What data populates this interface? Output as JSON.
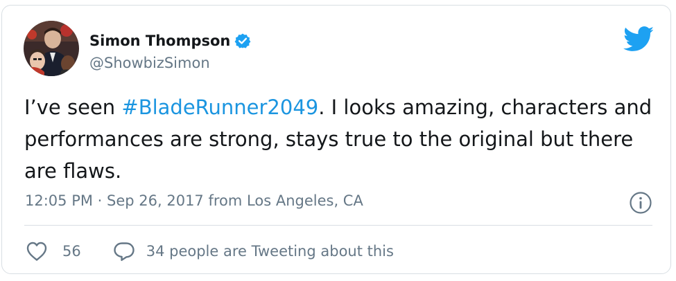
{
  "author": {
    "display_name": "Simon Thompson",
    "handle": "@ShowbizSimon",
    "verified": true,
    "avatar_icon": "profile-photo"
  },
  "tweet": {
    "text_before": "I’ve seen ",
    "hashtag": "#BladeRunner2049",
    "text_after": ". I looks amazing, characters and performances are strong, stays true to the original but there are flaws."
  },
  "meta": {
    "time": "12:05 PM",
    "separator": " · ",
    "date": "Sep 26, 2017",
    "from_label": " from ",
    "location": "Los Angeles, CA"
  },
  "actions": {
    "like_count": "56",
    "reply_text": "34 people are Tweeting about this"
  },
  "icons": {
    "brand": "twitter-bird-icon",
    "info": "info-icon",
    "like": "heart-icon",
    "reply": "speech-bubble-icon",
    "verified": "verified-badge-icon"
  },
  "colors": {
    "brand_blue": "#1da1f2",
    "hashtag_blue": "#1b95e0",
    "text_primary": "#14171a",
    "text_secondary": "#657786",
    "border": "#d8dee3"
  }
}
